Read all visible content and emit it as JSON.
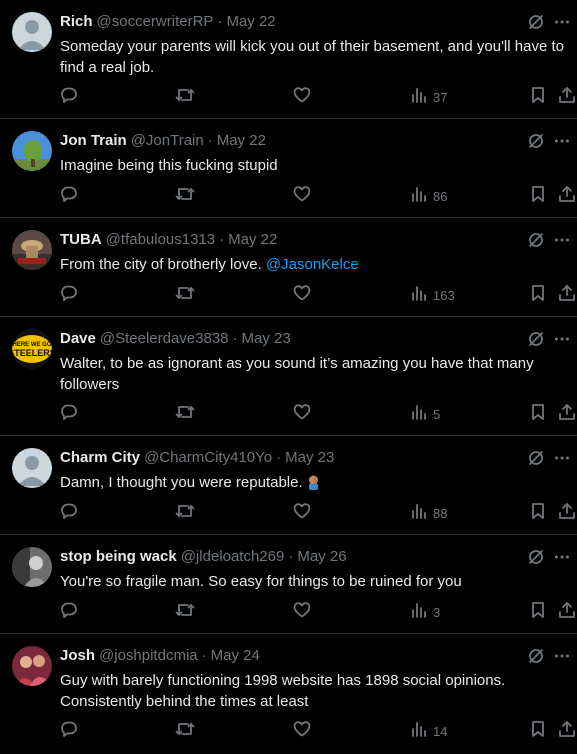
{
  "colors": {
    "background": "#000000",
    "text_primary": "#e7e9ea",
    "text_secondary": "#71767b",
    "link": "#1d9bf0",
    "divider": "#2f3336"
  },
  "icons": {
    "grok": "grok-icon",
    "more": "more-icon",
    "reply": "reply-icon",
    "retweet": "retweet-icon",
    "like": "like-icon",
    "views": "views-icon",
    "bookmark": "bookmark-icon",
    "share": "share-icon"
  },
  "separator": "·",
  "replies": [
    {
      "name": "Rich",
      "handle": "@soccerwriterRP",
      "date": "May 22",
      "text": "Someday your parents will kick you out of their basement, and you'll have to find a real job.",
      "views": "37"
    },
    {
      "name": "Jon Train",
      "handle": "@JonTrain",
      "date": "May 22",
      "text": "Imagine being this fucking stupid",
      "views": "86"
    },
    {
      "name": "TUBA",
      "handle": "@tfabulous1313",
      "date": "May 22",
      "text": "From the city of brotherly love.",
      "mention": "@JasonKelce",
      "views": "163"
    },
    {
      "name": "Dave",
      "handle": "@Steelerdave3838",
      "date": "May 23",
      "text": "Walter, to be as ignorant as you sound it’s amazing you have that many followers",
      "views": "5",
      "avatar_text": "HERE WE GO STEELERS"
    },
    {
      "name": "Charm City",
      "handle": "@CharmCity410Yo",
      "date": "May 23",
      "text": "Damn, I thought you were reputable.",
      "views": "88"
    },
    {
      "name": "stop being wack",
      "handle": "@jldeloatch269",
      "date": "May 26",
      "text": "You're so fragile man. So easy for things to be ruined for you",
      "views": "3"
    },
    {
      "name": "Josh",
      "handle": "@joshpitdcmia",
      "date": "May 24",
      "text": "Guy with barely functioning 1998 website has 1898 social opinions. Consistently behind the times at least",
      "views": "14"
    }
  ]
}
